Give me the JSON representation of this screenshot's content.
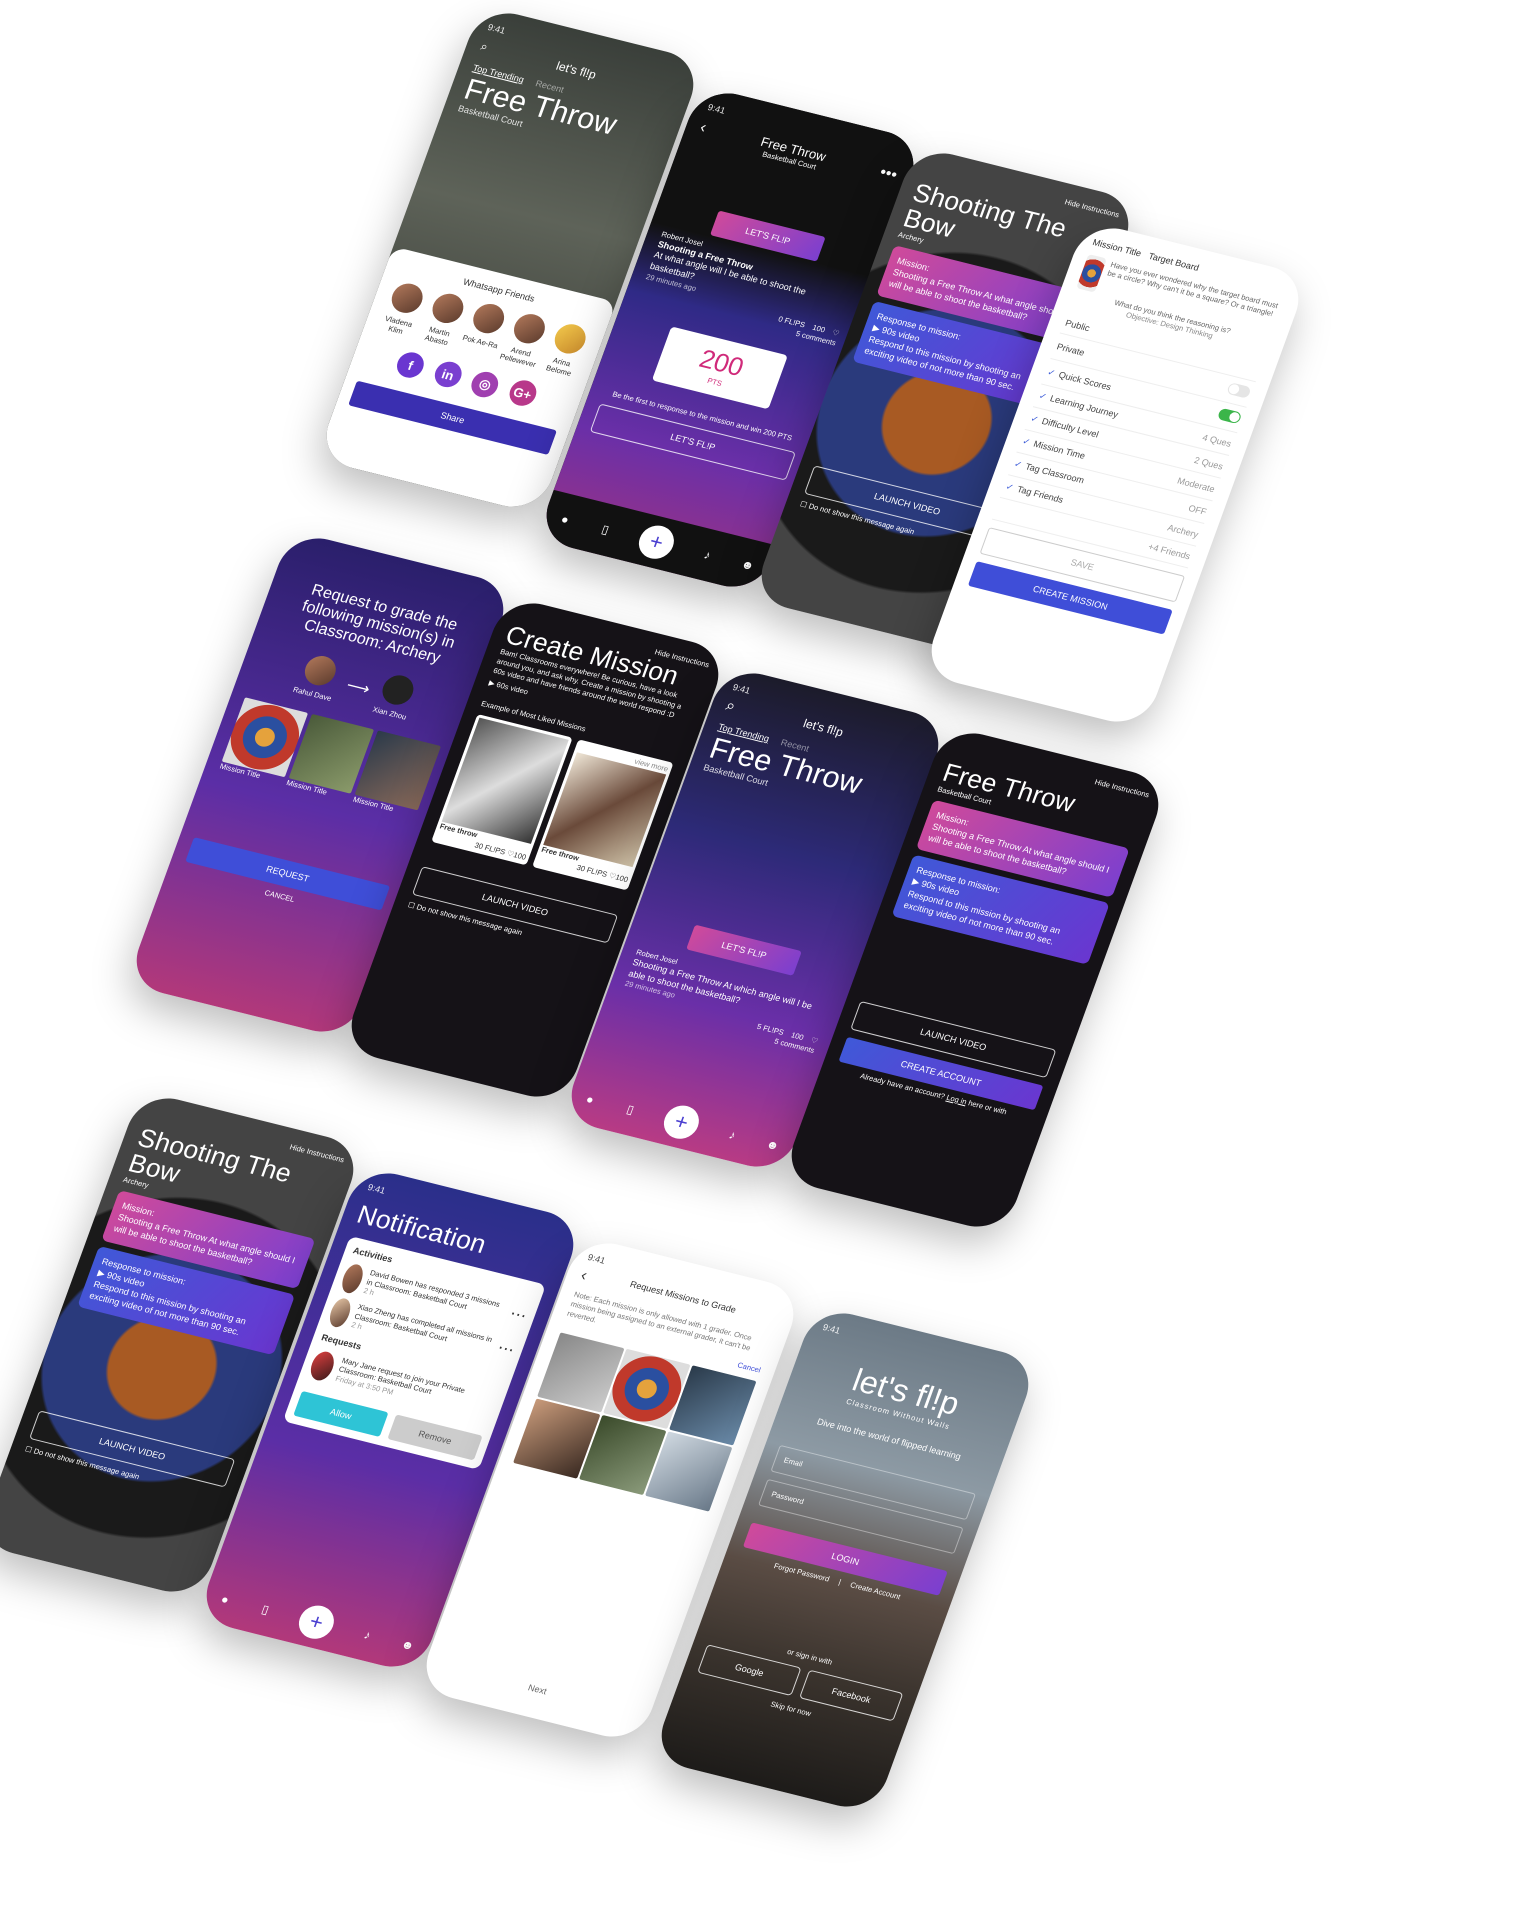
{
  "status_time": "9:41",
  "brand": "let's fl!p",
  "brand_tagline": "Classroom Without Walls",
  "trending": {
    "tab_top": "Top Trending",
    "tab_recent": "Recent",
    "title": "Free Throw",
    "location": "Basketball Court",
    "share_sheet_title": "Whatsapp Friends",
    "friends": [
      "Vladena Klim",
      "Martin Abasto",
      "Pok Ae-Ra",
      "Arend Pellewever",
      "Arina Belome"
    ],
    "share_label": "Share"
  },
  "free_throw": {
    "title": "Free Throw",
    "location": "Basketball Court",
    "lets_flip": "LET'S FL!P",
    "author": "Robert Josel",
    "post_title": "Shooting a Free Throw",
    "post_text": "At what angle will I be able to shoot the basketball?",
    "time_ago": "29 minutes ago",
    "flips": "0 FL!PS",
    "likes": "100",
    "comments": "5 comments",
    "points": "200",
    "points_unit": "PTS",
    "first_response": "Be the first to response to the mission and win 200 PTS",
    "cta": "LET'S FL!P"
  },
  "shooting_bow": {
    "hide_instructions": "Hide Instructions",
    "title": "Shooting The Bow",
    "tag": "Archery",
    "mission_label": "Mission:",
    "mission_text": "Shooting a Free Throw At what angle should I will be able to shoot the basketball?",
    "response_label": "Response to mission:",
    "response_video": "90s video",
    "respond_text": "Respond to this mission by shooting an exciting video of not more than 90 sec.",
    "launch_video": "LAUNCH VIDEO",
    "dont_show": "Do not show this message again"
  },
  "mission_settings": {
    "mission_title": "Mission Title",
    "target_board": "Target Board",
    "question": "Have you ever wondered why the target board must be a circle? Why can't it be a square? Or a triangle!",
    "prompt": "What do you think the reasoning is?",
    "objective": "Objective: Design Thinking",
    "rows": [
      {
        "label": "Public",
        "value": "",
        "checked": false,
        "toggle": "none"
      },
      {
        "label": "Private",
        "value": "",
        "checked": false,
        "toggle": "off"
      },
      {
        "label": "Quick Scores",
        "value": "",
        "checked": true,
        "toggle": "on"
      },
      {
        "label": "Learning Journey",
        "value": "4 Ques",
        "checked": true,
        "toggle": "none"
      },
      {
        "label": "Difficulty Level",
        "value": "2 Ques",
        "checked": true,
        "toggle": "none"
      },
      {
        "label": "Mission Time",
        "value": "Moderate",
        "checked": true,
        "toggle": "none"
      },
      {
        "label": "Tag Classroom",
        "value": "OFF",
        "checked": true,
        "toggle": "none"
      },
      {
        "label": "Tag Friends",
        "value": "Archery",
        "checked": true,
        "toggle": "none"
      },
      {
        "label": "",
        "value": "+4 Friends",
        "checked": false,
        "toggle": "none"
      }
    ],
    "save": "SAVE",
    "create": "CREATE MISSION"
  },
  "grade_request": {
    "title": "Request to grade the following mission(s) in Classroom: Archery",
    "from": "Rahul Dave",
    "to": "Xian Zhou",
    "thumb_label": "Mission Title",
    "request": "REQUEST",
    "cancel": "CANCEL"
  },
  "create_mission": {
    "hide_instructions": "Hide Instructions",
    "title": "Create Mission",
    "text": "Bam! Classrooms everywhere! Be curious, have a look around you, and ask why. Create a mission by shooting a 60s video and have friends around the world respond :D",
    "video": "60s video",
    "examples_label": "Example of Most Liked Missions",
    "view_more": "view more",
    "example_title": "Free throw",
    "example_flips": "30 FL!PS",
    "example_likes": "100",
    "launch_video": "LAUNCH VIDEO",
    "dont_show": "Do not show this message again"
  },
  "feed2": {
    "tab_top": "Top Trending",
    "tab_recent": "Recent",
    "title": "Free Throw",
    "location": "Basketball Court",
    "lets_flip": "LET'S FL!P",
    "author": "Robert Josel",
    "post": "Shooting a Free Throw At which angle will I be able to shoot the basketball?",
    "time_ago": "29 minutes ago",
    "flips": "5 FL!PS",
    "likes": "100",
    "comments": "5 comments"
  },
  "free_throw_instr": {
    "hide_instructions": "Hide Instructions",
    "title": "Free Throw",
    "location": "Basketball Court",
    "mission_label": "Mission:",
    "mission_text": "Shooting a Free Throw At what angle should I will be able to shoot the basketball?",
    "response_label": "Response to mission:",
    "response_video": "90s video",
    "respond_text": "Respond to this mission by shooting an exciting video of not more than 90 sec.",
    "launch_video": "LAUNCH VIDEO",
    "create_account": "CREATE ACCOUNT",
    "have_account": "Already have an account?",
    "login_link": "Log in",
    "here_or_with": "here or with"
  },
  "notification": {
    "title": "Notification",
    "activities": "Activities",
    "items": [
      {
        "text": "David Bowen has responded 3 missions in Classroom: Basketball Court",
        "time": "2 h"
      },
      {
        "text": "Xiao Zheng has completed all missions in Classroom: Basketball Court",
        "time": "2 h"
      }
    ],
    "requests": "Requests",
    "request_text": "Mary Jane request to join your Private Classroom: Basketball Court",
    "request_time": "Friday at 3:50 PM",
    "allow": "Allow",
    "remove": "Remove"
  },
  "request_grade": {
    "title": "Request Missions to Grade",
    "note": "Note: Each mission is only allowed with 1 grader. Once mission being assigned to an external grader, it can't be reverted.",
    "cancel": "Cancel",
    "next": "Next"
  },
  "login": {
    "tagline": "Dive into the world of flipped learning",
    "email": "Email",
    "password": "Password",
    "login": "LOGIN",
    "forgot": "Forgot Password",
    "create": "Create Account",
    "or_sign_in": "or sign in with",
    "google": "Google",
    "facebook": "Facebook",
    "skip": "Skip for now"
  },
  "colors": {
    "accent": "#3f4ed8",
    "pink": "#d04a9a",
    "purple": "#6a36d0",
    "toggle_on": "#3bb54a"
  }
}
